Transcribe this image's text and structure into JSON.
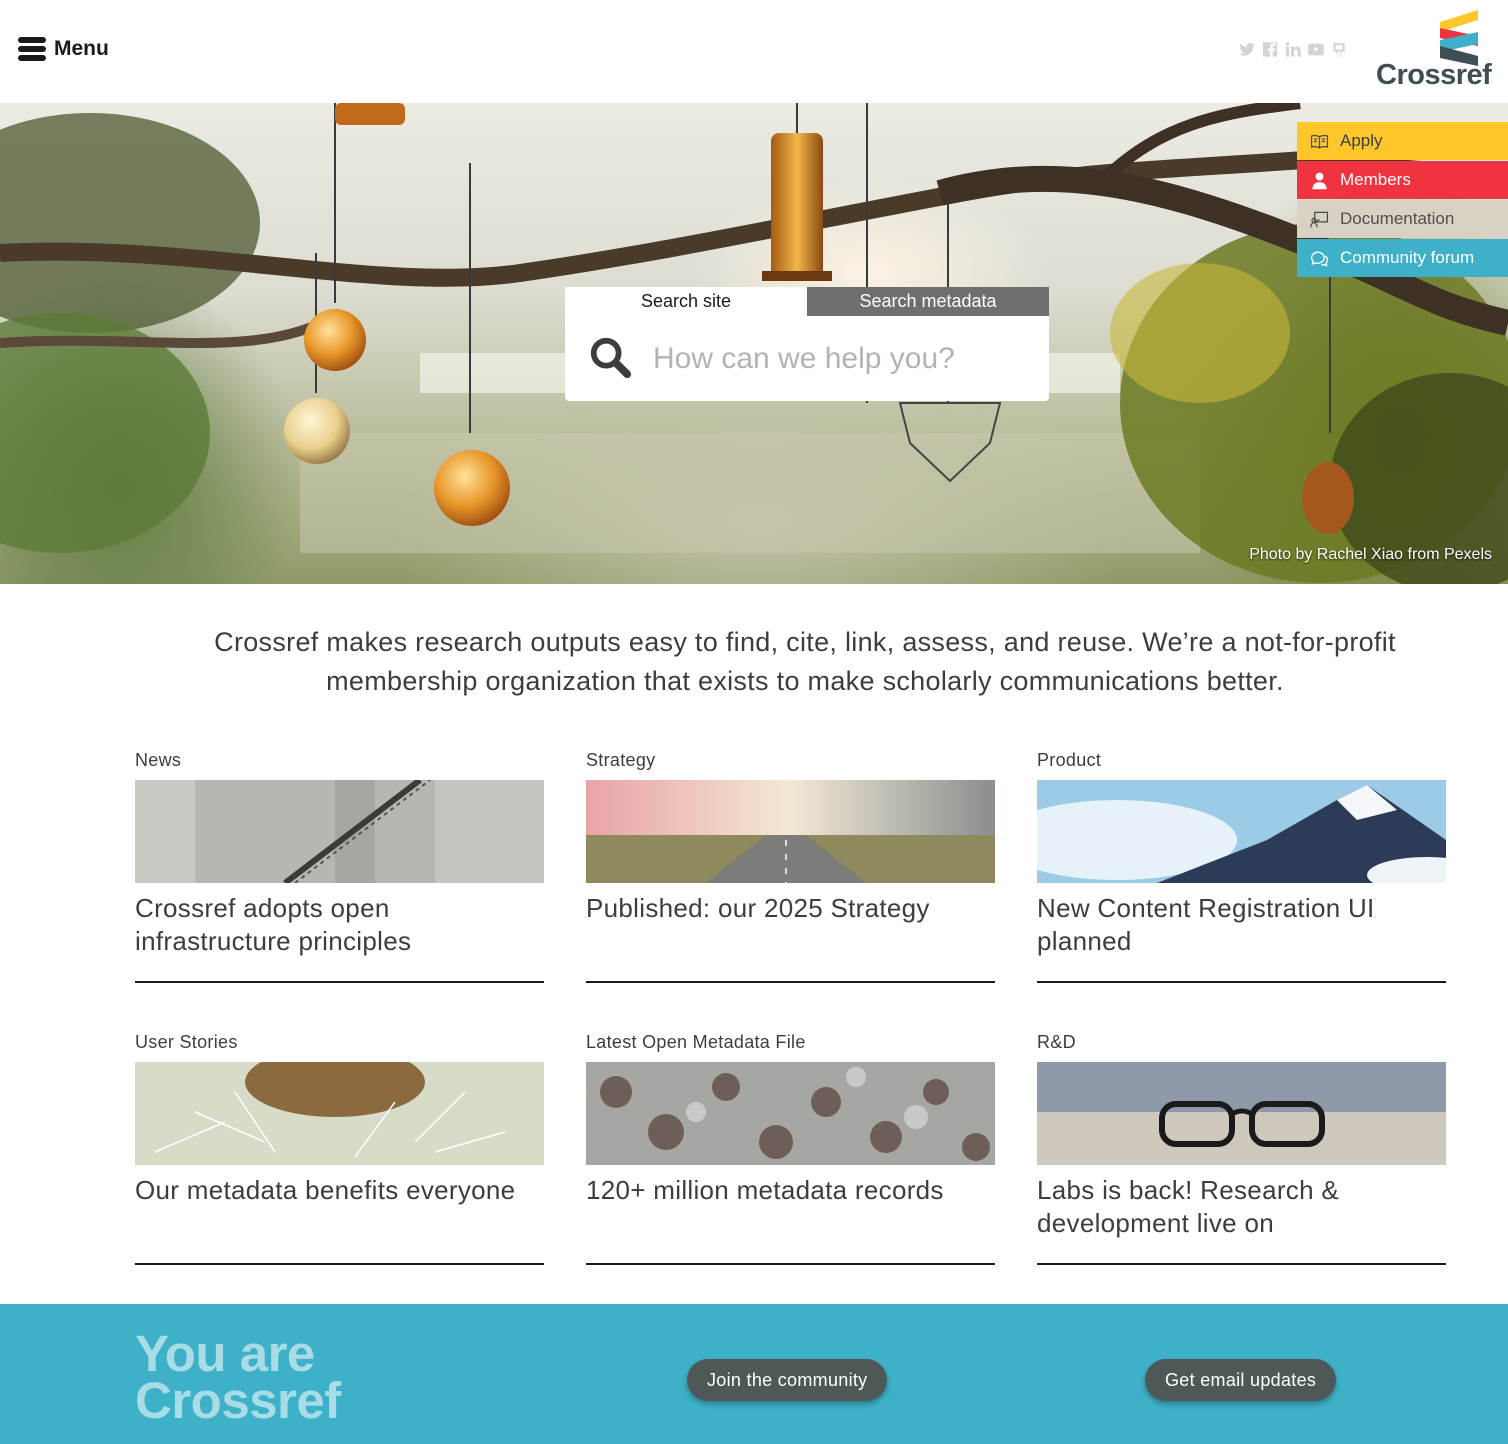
{
  "header": {
    "menu_label": "Menu",
    "social_icons": [
      "twitter-icon",
      "facebook-icon",
      "linkedin-icon",
      "youtube-icon",
      "gitlab-icon"
    ],
    "logo_text": "Crossref",
    "logo_colors": [
      "#ffc72c",
      "#ef3340",
      "#3eb1c8",
      "#3f4e55"
    ]
  },
  "hero": {
    "photo_credit": "Photo by Rachel Xiao from Pexels",
    "quick_links": [
      {
        "label": "Apply",
        "icon": "book-icon",
        "color": "#ffc72c"
      },
      {
        "label": "Members",
        "icon": "person-icon",
        "color": "#ef3340"
      },
      {
        "label": "Documentation",
        "icon": "presentation-icon",
        "color": "#d8d2c4"
      },
      {
        "label": "Community forum",
        "icon": "chat-icon",
        "color": "#3eb1c8"
      }
    ],
    "search": {
      "tab_site": "Search site",
      "tab_metadata": "Search metadata",
      "active_tab": "Search site",
      "placeholder": "How can we help you?",
      "value": ""
    }
  },
  "intro": "Crossref makes research outputs easy to find, cite, link, assess, and reuse. We’re a not-for-profit membership organization that exists to make scholarly communications better.",
  "cards": [
    {
      "category": "News",
      "title": "Crossref adopts open infrastructure principles",
      "image": "concrete-stairs"
    },
    {
      "category": "Strategy",
      "title": "Published: our 2025 Strategy",
      "image": "open-road"
    },
    {
      "category": "Product",
      "title": "New Content Registration UI planned",
      "image": "snowy-mountain"
    },
    {
      "category": "User Stories",
      "title": "Our metadata benefits everyone",
      "image": "dandelion"
    },
    {
      "category": "Latest Open Metadata File",
      "title": "120+ million metadata records",
      "image": "aerial-forest"
    },
    {
      "category": "R&D",
      "title": "Labs is back! Research & development live on",
      "image": "eyeglasses"
    }
  ],
  "band": {
    "title_line1": "You are",
    "title_line2": "Crossref",
    "join_label": "Join the community",
    "email_label": "Get email updates",
    "color": "#3eb1c8"
  }
}
